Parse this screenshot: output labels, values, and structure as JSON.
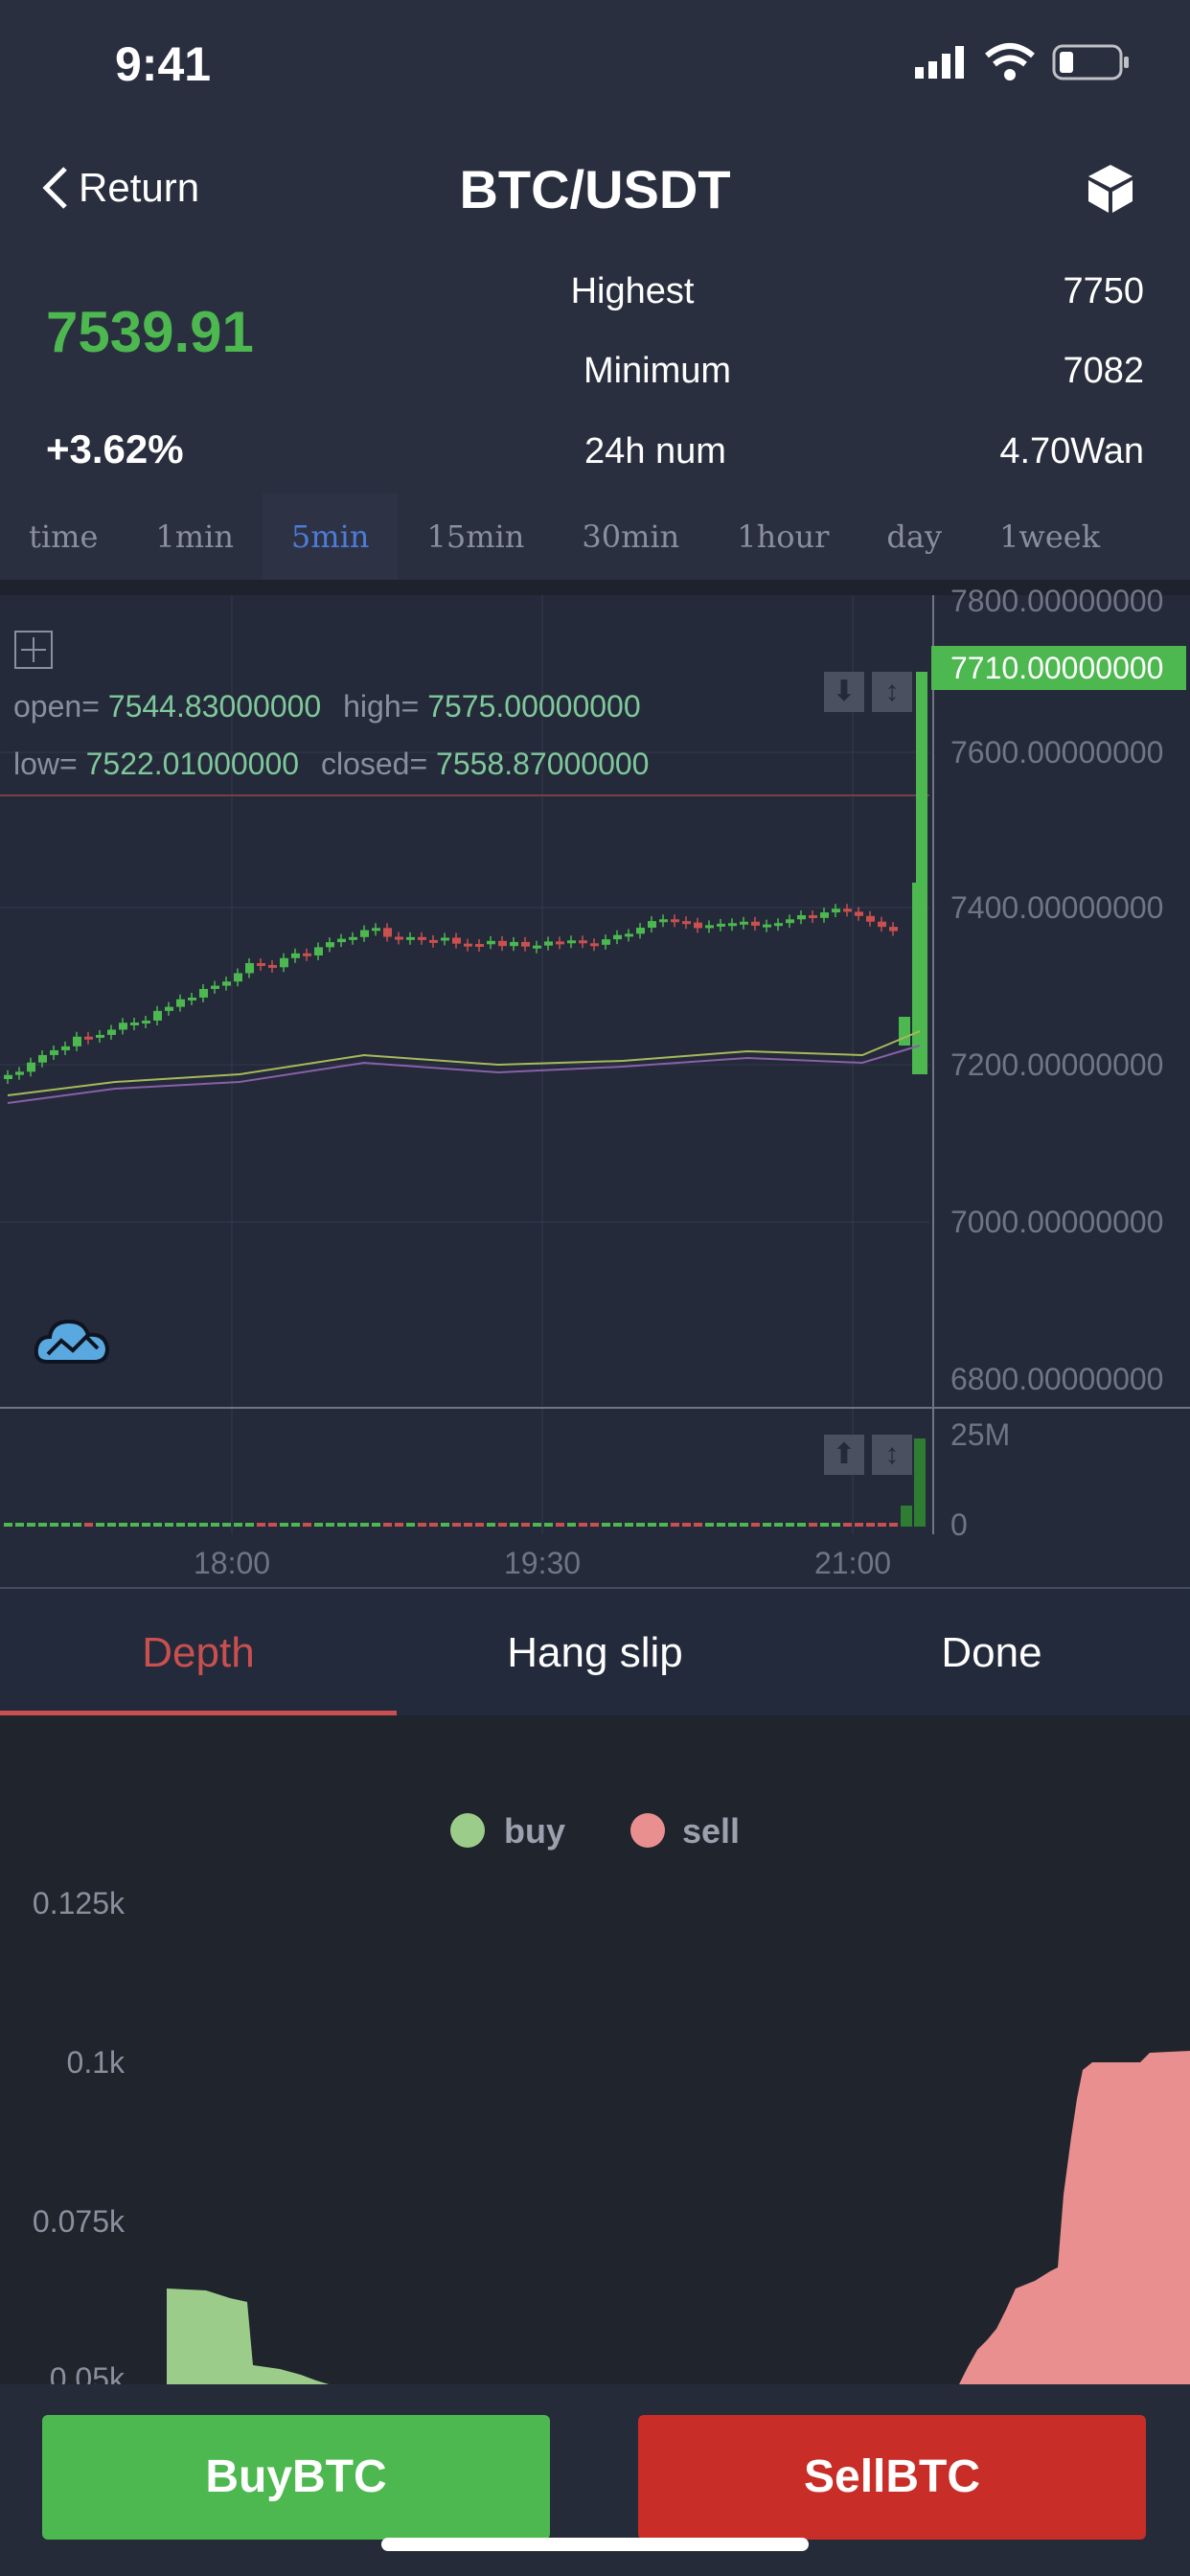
{
  "status": {
    "time": "9:41"
  },
  "nav": {
    "back_label": "Return",
    "title": "BTC/USDT"
  },
  "ticker": {
    "price": "7539.91",
    "change": "+3.62%",
    "stats": [
      {
        "label": "Highest",
        "value": "7750"
      },
      {
        "label": "Minimum",
        "value": "7082"
      },
      {
        "label": "24h num",
        "value": "4.70Wan"
      }
    ]
  },
  "timeframes": {
    "active": "5min",
    "items": [
      "time",
      "1min",
      "5min",
      "15min",
      "30min",
      "1hour",
      "day",
      "1week"
    ]
  },
  "kline": {
    "ohlc": {
      "open_label": "open=",
      "open": "7544.83000000",
      "high_label": "high=",
      "high": "7575.00000000",
      "low_label": "low=",
      "low": "7522.01000000",
      "close_label": "closed=",
      "close": "7558.87000000"
    },
    "current_price_tag": "7710.00000000",
    "y_ticks": [
      "7800.00000000",
      "7600.00000000",
      "7400.00000000",
      "7200.00000000",
      "7000.00000000",
      "6800.00000000"
    ],
    "volume_ticks": [
      "25M",
      "0"
    ],
    "x_ticks": [
      "18:00",
      "19:30",
      "21:00"
    ],
    "colors": {
      "up": "#4cb84f",
      "down": "#c9504f"
    }
  },
  "section_tabs": {
    "items": [
      "Depth",
      "Hang slip",
      "Done"
    ],
    "active": "Depth"
  },
  "depth": {
    "legend": [
      {
        "name": "buy",
        "color": "#9ccc8a"
      },
      {
        "name": "sell",
        "color": "#ea8f8f"
      }
    ],
    "y_ticks": [
      "0.125k",
      "0.1k",
      "0.075k",
      "0.05k"
    ]
  },
  "actions": {
    "buy_label": "BuyBTC",
    "sell_label": "SellBTC",
    "buy_color": "#4cb84f",
    "sell_color": "#c92d27"
  }
}
